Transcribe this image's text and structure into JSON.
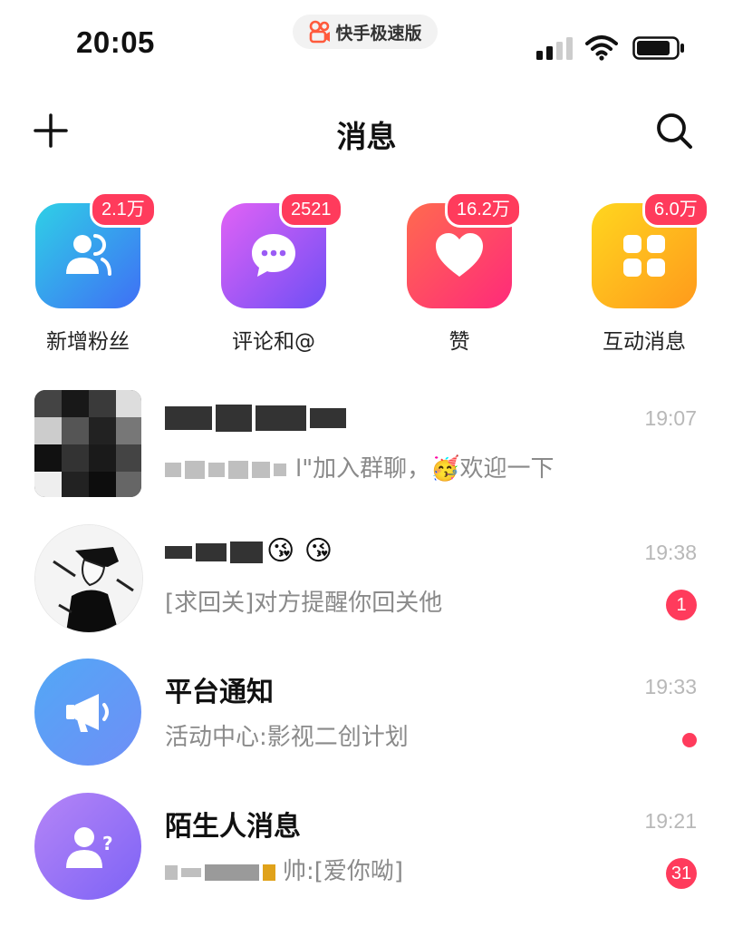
{
  "status_bar": {
    "time": "20:05",
    "app_name": "快手极速版"
  },
  "nav": {
    "title": "消息"
  },
  "shortcuts": [
    {
      "label": "新增粉丝",
      "badge": "2.1万",
      "icon": "followers-icon"
    },
    {
      "label": "评论和@",
      "badge": "2521",
      "icon": "comment-icon"
    },
    {
      "label": "赞",
      "badge": "16.2万",
      "icon": "heart-icon"
    },
    {
      "label": "互动消息",
      "badge": "6.0万",
      "icon": "grid-icon"
    }
  ],
  "conversations": [
    {
      "name": "",
      "preview": "l\"加入群聊，🥳欢迎一下",
      "time": "19:07",
      "unread": ""
    },
    {
      "name": "😘 😘",
      "preview": "[求回关]对方提醒你回关他",
      "time": "19:38",
      "unread": "1"
    },
    {
      "name": "平台通知",
      "preview": "活动中心:影视二创计划",
      "time": "19:33",
      "unread": ""
    },
    {
      "name": "陌生人消息",
      "preview": "帅:[爱你呦]",
      "time": "19:21",
      "unread": "31"
    }
  ],
  "colors": {
    "accent": "#ff3b5c",
    "followers_tile": [
      "#2fd0e6",
      "#3f6ff5"
    ],
    "comment_tile": [
      "#e162f5",
      "#6f4ff5"
    ],
    "heart_tile": [
      "#ff6a4f",
      "#ff2a7a"
    ],
    "grid_tile": [
      "#ffd61f",
      "#ff9a1c"
    ]
  }
}
